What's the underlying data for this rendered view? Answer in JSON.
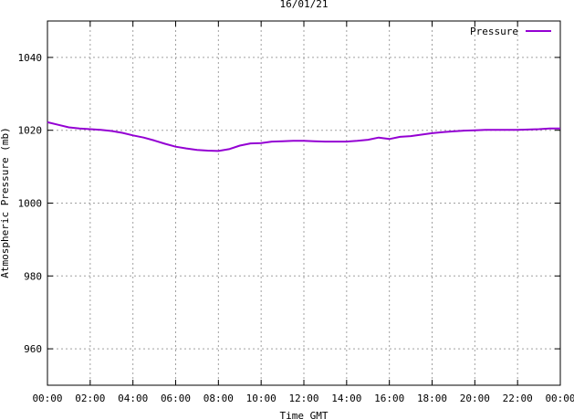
{
  "chart_data": {
    "type": "line",
    "title": "16/01/21",
    "xlabel": "Time GMT",
    "ylabel": "Atmospheric Pressure (mb)",
    "xlim": [
      0,
      24
    ],
    "ylim": [
      950,
      1050
    ],
    "yticks": [
      960,
      980,
      1000,
      1020,
      1040
    ],
    "xtick_labels": [
      "00:00",
      "02:00",
      "04:00",
      "06:00",
      "08:00",
      "10:00",
      "12:00",
      "14:00",
      "16:00",
      "18:00",
      "20:00",
      "22:00",
      "00:00"
    ],
    "grid": true,
    "legend_position": "top-right",
    "series": [
      {
        "name": "Pressure",
        "color": "#9400d3",
        "x": [
          0.0,
          0.5,
          1.0,
          1.5,
          2.0,
          2.5,
          3.0,
          3.5,
          4.0,
          4.5,
          5.0,
          5.5,
          6.0,
          6.5,
          7.0,
          7.5,
          8.0,
          8.5,
          9.0,
          9.5,
          10.0,
          10.5,
          11.0,
          11.5,
          12.0,
          12.5,
          13.0,
          13.5,
          14.0,
          14.5,
          15.0,
          15.5,
          16.0,
          16.5,
          17.0,
          17.5,
          18.0,
          18.5,
          19.0,
          19.5,
          20.0,
          20.5,
          21.0,
          21.5,
          22.0,
          22.5,
          23.0,
          23.5,
          24.0
        ],
        "y": [
          1022.2,
          1021.5,
          1020.8,
          1020.5,
          1020.3,
          1020.1,
          1019.8,
          1019.3,
          1018.6,
          1018.0,
          1017.2,
          1016.3,
          1015.5,
          1015.0,
          1014.6,
          1014.4,
          1014.3,
          1014.8,
          1015.8,
          1016.4,
          1016.5,
          1016.9,
          1017.0,
          1017.1,
          1017.1,
          1017.0,
          1016.9,
          1016.9,
          1016.9,
          1017.1,
          1017.4,
          1018.0,
          1017.6,
          1018.2,
          1018.4,
          1018.8,
          1019.2,
          1019.5,
          1019.7,
          1019.9,
          1020.0,
          1020.1,
          1020.1,
          1020.1,
          1020.1,
          1020.2,
          1020.3,
          1020.5,
          1020.5
        ]
      }
    ]
  }
}
